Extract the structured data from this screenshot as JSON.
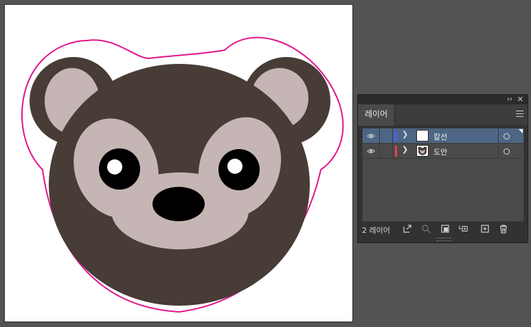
{
  "panel": {
    "tab_label": "레이어",
    "layer_count_label": "2 레이어",
    "layers": [
      {
        "name": "칼선",
        "color": "#4a5cff",
        "selected": true
      },
      {
        "name": "도안",
        "color": "#e8404f",
        "selected": false
      }
    ]
  },
  "artwork": {
    "cut_line_color": "#e0148a",
    "bear_dark_color": "#473c36",
    "bear_light_color": "#c6b5b5",
    "eye_color": "#000000",
    "highlight_color": "#ffffff"
  },
  "icons": {
    "collapse": "double-chevron-left",
    "close": "x",
    "visibility": "eye",
    "expand": "chevron-right",
    "target": "circle",
    "release": "export-arrow",
    "locate": "magnifier",
    "clipping-mask": "mask",
    "sublayer": "new-sublayer",
    "new-layer": "plus-square",
    "delete": "trash"
  }
}
